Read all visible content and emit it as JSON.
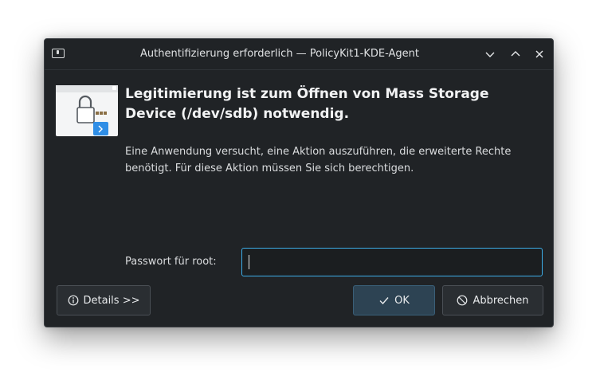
{
  "window": {
    "title": "Authentifizierung erforderlich — PolicyKit1-KDE-Agent",
    "controls": {
      "minimize": "⌄",
      "maximize": "⌃",
      "close": "✕"
    }
  },
  "dialog": {
    "icon": "drive-lock-icon",
    "headline": "Legitimierung ist zum Öffnen von Mass Storage Device (/dev/sdb) notwendig.",
    "description": "Eine Anwendung versucht, eine Aktion auszuführen, die erweiterte Rechte benötigt. Für diese Aktion müssen Sie sich berechtigen.",
    "password_label": "Passwort für root:",
    "password_value": ""
  },
  "buttons": {
    "details": "Details >>",
    "ok": "OK",
    "cancel": "Abbrechen"
  },
  "colors": {
    "window_bg": "#202326",
    "focus_accent": "#3daee9",
    "ok_button_bg": "#2d4353"
  }
}
